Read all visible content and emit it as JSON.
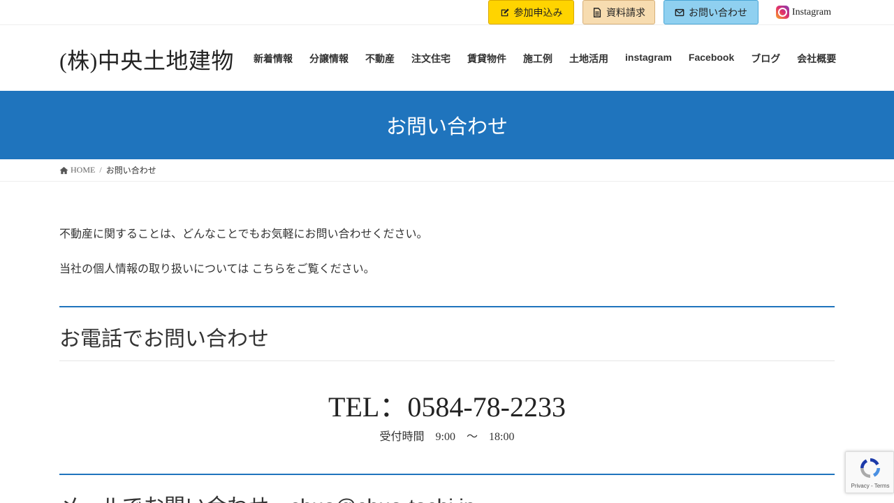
{
  "topbar": {
    "entry_label": "参加申込み",
    "docs_label": "資料請求",
    "contact_label": "お問い合わせ",
    "instagram_label": "Instagram"
  },
  "header": {
    "logo": "(株)中央土地建物",
    "nav": [
      {
        "label": "新着情報"
      },
      {
        "label": "分譲情報"
      },
      {
        "label": "不動産"
      },
      {
        "label": "注文住宅"
      },
      {
        "label": "賃貸物件"
      },
      {
        "label": "施工例"
      },
      {
        "label": "土地活用"
      },
      {
        "label": "instagram"
      },
      {
        "label": "Facebook"
      },
      {
        "label": "ブログ"
      },
      {
        "label": "会社概要"
      }
    ]
  },
  "page": {
    "title": "お問い合わせ"
  },
  "breadcrumb": {
    "home": "HOME",
    "separator": "/",
    "current": "お問い合わせ"
  },
  "content": {
    "intro": "不動産に関することは、どんなことでもお気軽にお問い合わせください。",
    "privacy_prefix": "当社の個人情報の取り扱いについては ",
    "privacy_link": "こちらをご覧ください。",
    "phone_heading": "お電話でお問い合わせ",
    "tel": "TEL：0584-78-2233",
    "hours": "受付時間　9:00　～　18:00",
    "mail_heading": "メールでお問い合わせ　chuo@chuo-tochi.jp"
  },
  "recaptcha": {
    "links": "Privacy - Terms"
  },
  "colors": {
    "accent_blue": "#1f74bd",
    "entry_yellow": "#ffd400",
    "docs_beige": "#f7dcb0",
    "contact_blue": "#8fd0f0"
  }
}
